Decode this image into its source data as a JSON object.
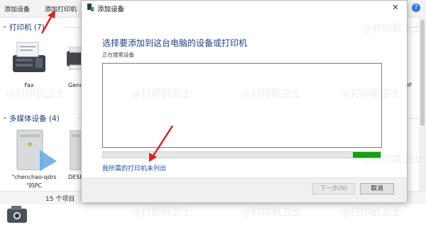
{
  "toolbar": {
    "add_device": "添加设备",
    "add_printer": "添加打印机",
    "help_icon": "?"
  },
  "groups": {
    "printers": {
      "title": "打印机 (7)"
    },
    "media": {
      "title": "多媒体设备 (4)"
    }
  },
  "devices": {
    "fax": "Fax",
    "generic": "Gene",
    "pdf": "PDF",
    "media1_line1": "\"chenchao-qdrs",
    "media1_line2": "\"的PC",
    "media2": "DESK"
  },
  "status": {
    "items_count": "15 个项目"
  },
  "dialog": {
    "title": "添加设备",
    "close": "✕",
    "heading": "选择要添加到这台电脑的设备或打印机",
    "subheading": "正在搜索设备",
    "progress": 0.1,
    "link": "我所需的打印机未列出",
    "next_button": "下一步(N)",
    "cancel_button": "取消"
  },
  "watermark": "@打印机卫士",
  "colors": {
    "heading": "#1f3f86",
    "link": "#1f4ea1",
    "progress": "#13a10e",
    "annotation_arrow": "#e02020"
  }
}
